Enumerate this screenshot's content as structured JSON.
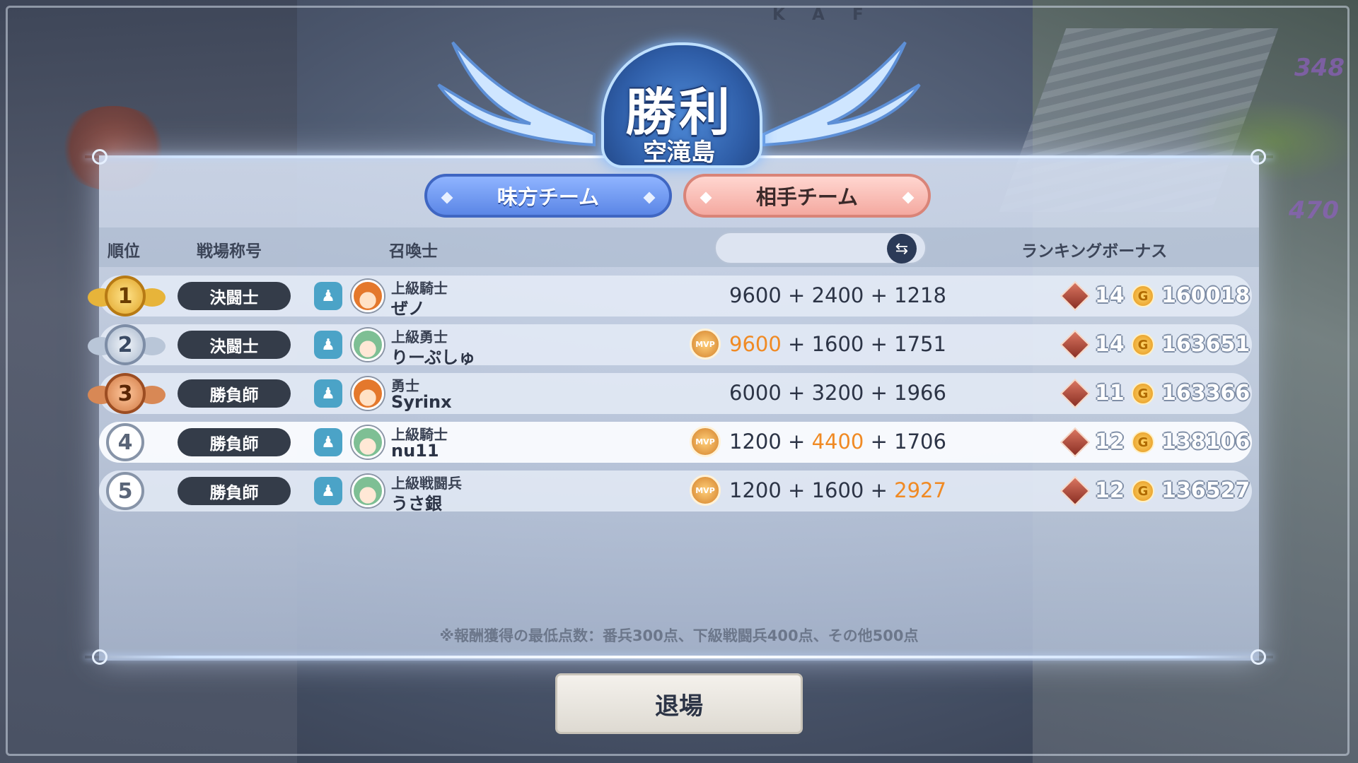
{
  "header": {
    "title": "勝利",
    "subtitle": "空滝島"
  },
  "tabs": [
    {
      "label": "味方チーム",
      "active": true
    },
    {
      "label": "相手チーム",
      "active": false
    }
  ],
  "columns": {
    "rank": "順位",
    "battle_title": "戦場称号",
    "summoner": "召喚士",
    "k": "K",
    "a": "A",
    "f": "F",
    "ranking_bonus": "ランキングボーナス"
  },
  "background_numbers": [
    "348",
    "470"
  ],
  "rows": [
    {
      "rank": "1",
      "battle_title": "決闘士",
      "rank_name": "上級騎士",
      "player": "ぜノ",
      "avatar": "orange",
      "mvp": false,
      "k": "9600",
      "a": "2400",
      "f": "1218",
      "highlight": null,
      "gems": "14",
      "coins": "160018",
      "selected": false
    },
    {
      "rank": "2",
      "battle_title": "決闘士",
      "rank_name": "上級勇士",
      "player": "りーぷしゅ",
      "avatar": "green",
      "mvp": true,
      "k": "9600",
      "a": "1600",
      "f": "1751",
      "highlight": "k",
      "gems": "14",
      "coins": "163651",
      "selected": false
    },
    {
      "rank": "3",
      "battle_title": "勝負師",
      "rank_name": "勇士",
      "player": "Syrinx",
      "avatar": "orange",
      "mvp": false,
      "k": "6000",
      "a": "3200",
      "f": "1966",
      "highlight": null,
      "gems": "11",
      "coins": "163366",
      "selected": false
    },
    {
      "rank": "4",
      "battle_title": "勝負師",
      "rank_name": "上級騎士",
      "player": "nu11",
      "avatar": "green",
      "mvp": true,
      "k": "1200",
      "a": "4400",
      "f": "1706",
      "highlight": "a",
      "gems": "12",
      "coins": "138106",
      "selected": true
    },
    {
      "rank": "5",
      "battle_title": "勝負師",
      "rank_name": "上級戦闘兵",
      "player": "うさ銀",
      "avatar": "green",
      "mvp": true,
      "k": "1200",
      "a": "1600",
      "f": "2927",
      "highlight": "f",
      "gems": "12",
      "coins": "136527",
      "selected": false
    }
  ],
  "mvp_label": "MVP",
  "plus": "+",
  "note": "※報酬獲得の最低点数：番兵300点、下級戦闘兵400点、その他500点",
  "exit_button": "退場",
  "colors": {
    "highlight": "#f08a24",
    "ally_tab": "#5b86e6",
    "enemy_tab": "#f4a9a0",
    "title_pill": "#343c49"
  }
}
